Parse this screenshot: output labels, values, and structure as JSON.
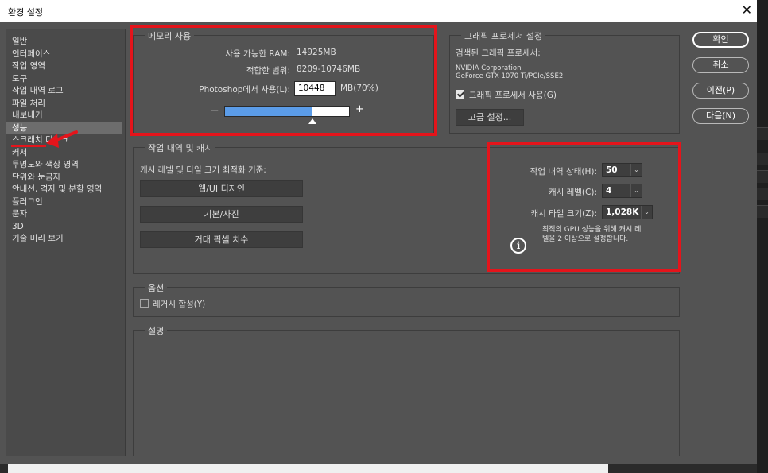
{
  "window": {
    "title": "환경 설정",
    "close_glyph": "✕"
  },
  "sidebar": {
    "items": [
      {
        "label": "일반"
      },
      {
        "label": "인터페이스"
      },
      {
        "label": "작업 영역"
      },
      {
        "label": "도구"
      },
      {
        "label": "작업 내역 로그"
      },
      {
        "label": "파일 처리"
      },
      {
        "label": "내보내기"
      },
      {
        "label": "성능",
        "selected": true
      },
      {
        "label": "스크래치 디스크"
      },
      {
        "label": "커서"
      },
      {
        "label": "투명도와 색상 영역"
      },
      {
        "label": "단위와 눈금자"
      },
      {
        "label": "안내선, 격자 및 분할 영역"
      },
      {
        "label": "플러그인"
      },
      {
        "label": "문자"
      },
      {
        "label": "3D"
      },
      {
        "label": "기술 미리 보기"
      }
    ]
  },
  "memory": {
    "legend": "메모리 사용",
    "available_label": "사용 가능한 RAM:",
    "available_value": "14925MB",
    "range_label": "적합한 범위:",
    "range_value": "8209-10746MB",
    "use_label": "Photoshop에서 사용(L):",
    "use_value": "10448",
    "use_unit": "MB(70%)",
    "minus_glyph": "−",
    "plus_glyph": "+",
    "slider_level_percent": 70
  },
  "gpu": {
    "legend": "그래픽 프로세서 설정",
    "detected_label": "검색된 그래픽 프로세서:",
    "vendor": "NVIDIA Corporation",
    "model": "GeForce GTX 1070 Ti/PCIe/SSE2",
    "use_label": "그래픽 프로세서 사용(G)",
    "use_checked": true,
    "advanced_button": "고급 설정..."
  },
  "history_cache": {
    "legend": "작업 내역 및 캐시",
    "optimize_label": "캐시 레벨 및 타일 크기 최적화 기준:",
    "presets": [
      "웹/UI 디자인",
      "기본/사진",
      "거대 픽셀 치수"
    ],
    "history_states_label": "작업 내역 상태(H):",
    "history_states_value": "50",
    "cache_levels_label": "캐시 레벨(C):",
    "cache_levels_value": "4",
    "cache_tile_label": "캐시 타일 크기(Z):",
    "cache_tile_value": "1,028K",
    "info_icon_glyph": "i",
    "info_line1": "최적의 GPU 성능을 위해 캐시 레",
    "info_line2": "벨을 2 이상으로 설정합니다.",
    "dropdown_glyph": "⌄"
  },
  "options": {
    "legend": "옵션",
    "legacy_label": "레거시 합성(Y)",
    "legacy_checked": false
  },
  "description": {
    "legend": "설명"
  },
  "buttons": {
    "ok": "확인",
    "cancel": "취소",
    "prev": "이전(P)",
    "next": "다음(N)"
  },
  "annotations": {
    "arrow_color": "#e4141b",
    "box_color": "#e4141b"
  },
  "colors": {
    "dialog_bg": "#535353",
    "slider_fill": "#5b9ce8",
    "annotation_red": "#e4141b"
  }
}
